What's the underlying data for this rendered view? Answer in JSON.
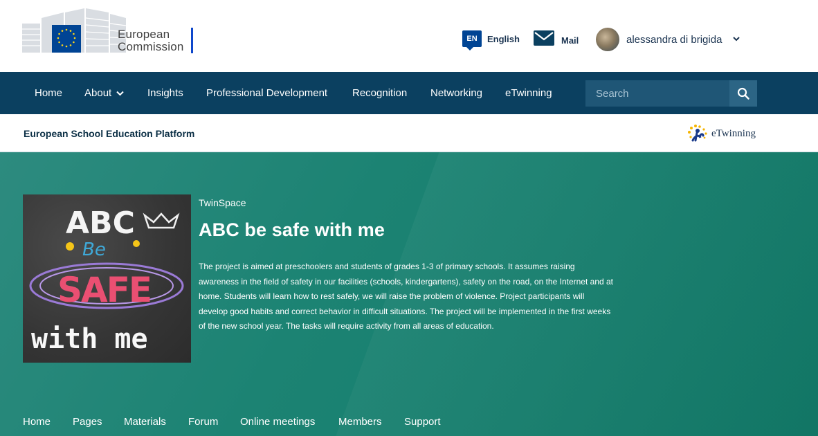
{
  "header": {
    "logo": {
      "line1": "European",
      "line2": "Commission"
    },
    "language": {
      "code": "EN",
      "label": "English"
    },
    "mail": {
      "label": "Mail"
    },
    "user": {
      "name": "alessandra di brigida"
    }
  },
  "main_nav": {
    "items": [
      {
        "label": "Home"
      },
      {
        "label": "About"
      },
      {
        "label": "Insights"
      },
      {
        "label": "Professional Development"
      },
      {
        "label": "Recognition"
      },
      {
        "label": "Networking"
      },
      {
        "label": "eTwinning"
      }
    ],
    "search": {
      "placeholder": "Search"
    }
  },
  "site": {
    "title": "European School Education Platform",
    "partner_logo": "eTwinning"
  },
  "project": {
    "kicker": "TwinSpace",
    "title": "ABC be safe with me",
    "image_text": {
      "line1": "ABC",
      "line2": "Be",
      "line3": "SAFE",
      "line4": "with me"
    },
    "description": "The project is aimed at preschoolers and students of grades 1-3 of primary schools. It assumes raising awareness in the field of safety in our facilities (schools, kindergartens), safety on the road, on the Internet and at home. Students will learn how to rest safely, we will raise the problem of violence. Project participants will develop good habits and correct behavior in difficult situations. The project will be implemented in the first weeks of the new school year. The tasks will require activity from all areas of education."
  },
  "sub_nav": {
    "items": [
      {
        "label": "Home"
      },
      {
        "label": "Pages"
      },
      {
        "label": "Materials"
      },
      {
        "label": "Forum"
      },
      {
        "label": "Online meetings"
      },
      {
        "label": "Members"
      },
      {
        "label": "Support"
      }
    ]
  },
  "colors": {
    "nav_bg": "#0b4060",
    "hero_bg": "#1c8373",
    "brand_blue": "#004494",
    "flag_yellow": "#ffd617"
  }
}
